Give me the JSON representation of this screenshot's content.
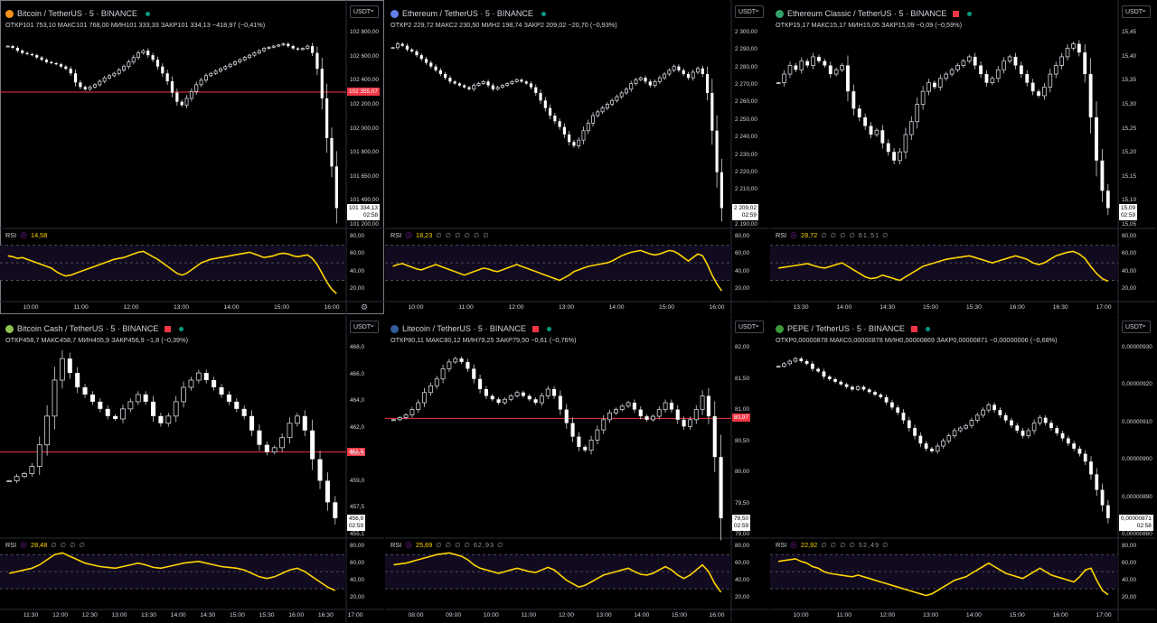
{
  "accent": {
    "up": "#ffffff",
    "down": "#ffffff",
    "rsi_line": "#ffd400",
    "last_line": "#f23645",
    "badge": "#f23645",
    "live_dot": "#089981"
  },
  "panes": [
    {
      "id": "btc",
      "title": "Bitcoin / TetherUS · 5 · BINANCE",
      "icon_color": "#f7931a",
      "flag": false,
      "active": true,
      "ohlc": "ОТКР101 753,10  МАКС101 768,00  МИН101 333,33  ЗАКР101 334,13  −418,97 (−0,41%)",
      "currency": "USDT",
      "y_labels": [
        "102 800,00",
        "102 600,00",
        "102 400,00",
        "102 200,00",
        "102 000,00",
        "101 800,00",
        "101 650,00",
        "101 490,00",
        "101 200,00"
      ],
      "last_line_label": "102 355,07",
      "price_tag": [
        "101 334,13",
        "02:58"
      ],
      "rsi": {
        "label": "RSI",
        "value": "14,58",
        "extra": ""
      },
      "rsi_levels": [
        "80,00",
        "60,00",
        "40,00",
        "20,00"
      ],
      "x_labels": [
        "10:00",
        "11:00",
        "12:00",
        "13:00",
        "14:00",
        "15:00",
        "16:00"
      ],
      "gear": true,
      "closes": [
        102760,
        102745,
        102720,
        102700,
        102690,
        102680,
        102660,
        102640,
        102620,
        102610,
        102600,
        102580,
        102560,
        102520,
        102440,
        102400,
        102380,
        102400,
        102420,
        102450,
        102480,
        102500,
        102520,
        102550,
        102580,
        102620,
        102660,
        102700,
        102720,
        102680,
        102640,
        102580,
        102520,
        102450,
        102350,
        102270,
        102240,
        102300,
        102360,
        102420,
        102460,
        102500,
        102520,
        102540,
        102560,
        102580,
        102600,
        102620,
        102640,
        102660,
        102680,
        102700,
        102720,
        102740,
        102750,
        102760,
        102770,
        102780,
        102760,
        102740,
        102730,
        102740,
        102760,
        102700,
        102560,
        102300,
        101950,
        101700,
        101334
      ],
      "rsi_values": [
        58,
        57,
        55,
        56,
        54,
        52,
        50,
        48,
        46,
        44,
        40,
        37,
        35,
        36,
        38,
        40,
        42,
        44,
        46,
        48,
        50,
        52,
        54,
        55,
        56,
        58,
        60,
        62,
        63,
        60,
        57,
        54,
        50,
        46,
        42,
        38,
        36,
        38,
        42,
        46,
        50,
        52,
        54,
        55,
        56,
        57,
        58,
        59,
        60,
        61,
        62,
        60,
        58,
        56,
        57,
        58,
        60,
        61,
        60,
        58,
        57,
        58,
        59,
        55,
        48,
        38,
        28,
        20,
        15
      ]
    },
    {
      "id": "eth",
      "title": "Ethereum / TetherUS · 5 · BINANCE",
      "icon_color": "#627eea",
      "flag": false,
      "active": false,
      "ohlc": "ОТКР2 229,72  МАКС2 230,50  МИН2 198,74  ЗАКР2 209,02  −20,70 (−0,93%)",
      "currency": "USDT",
      "y_labels": [
        "2 300,00",
        "2 290,00",
        "2 280,00",
        "2 270,00",
        "2 260,00",
        "2 250,00",
        "2 240,00",
        "2 230,00",
        "2 220,00",
        "2 210,00",
        "2 200,00",
        "2 190,00"
      ],
      "last_line_label": "",
      "price_tag": [
        "2 209,02",
        "02:59"
      ],
      "rsi": {
        "label": "RSI",
        "value": "18,23",
        "extra": "∅ ∅ ∅ ∅ ∅ ∅"
      },
      "rsi_levels": [
        "80,00",
        "60,00",
        "40,00",
        "20,00"
      ],
      "x_labels": [
        "10:00",
        "11:00",
        "12:00",
        "13:00",
        "14:00",
        "15:00",
        "16:00"
      ],
      "gear": false,
      "closes": [
        2294,
        2296,
        2295,
        2293,
        2292,
        2290,
        2288,
        2286,
        2284,
        2282,
        2280,
        2278,
        2276,
        2275,
        2274,
        2273,
        2272,
        2274,
        2275,
        2276,
        2274,
        2272,
        2273,
        2274,
        2275,
        2276,
        2277,
        2276,
        2275,
        2273,
        2270,
        2266,
        2262,
        2258,
        2255,
        2252,
        2248,
        2244,
        2242,
        2245,
        2250,
        2254,
        2258,
        2260,
        2262,
        2264,
        2266,
        2268,
        2270,
        2272,
        2275,
        2277,
        2278,
        2276,
        2274,
        2276,
        2278,
        2280,
        2282,
        2284,
        2282,
        2280,
        2278,
        2281,
        2283,
        2280,
        2270,
        2250,
        2228,
        2209
      ],
      "rsi_values": [
        46,
        48,
        49,
        47,
        45,
        43,
        42,
        44,
        46,
        48,
        46,
        44,
        42,
        40,
        38,
        36,
        38,
        40,
        42,
        44,
        43,
        41,
        40,
        42,
        44,
        46,
        48,
        46,
        44,
        42,
        40,
        38,
        36,
        34,
        32,
        30,
        33,
        36,
        40,
        42,
        44,
        46,
        47,
        48,
        49,
        50,
        52,
        55,
        58,
        60,
        62,
        63,
        64,
        62,
        60,
        59,
        60,
        62,
        64,
        63,
        60,
        56,
        52,
        56,
        60,
        58,
        48,
        36,
        26,
        18
      ]
    },
    {
      "id": "etc",
      "title": "Ethereum Classic / TetherUS · 5 · BINANCE",
      "icon_color": "#33a36b",
      "flag": true,
      "active": false,
      "ohlc": "ОТКР15,17  МАКС15,17  МИН15,05  ЗАКР15,09  −0,09 (−0,59%)",
      "currency": "USDT",
      "y_labels": [
        "15,45",
        "15,40",
        "15,35",
        "15,30",
        "15,25",
        "15,20",
        "15,15",
        "15,10",
        "15,05"
      ],
      "last_line_label": "",
      "price_tag": [
        "15,09",
        "02:59"
      ],
      "rsi": {
        "label": "RSI",
        "value": "28,72",
        "extra": "∅ ∅ ∅ ∅  61,51  ∅"
      },
      "rsi_levels": [
        "80,00",
        "60,00",
        "40,00",
        "20,00"
      ],
      "x_labels": [
        "13:30",
        "14:00",
        "14:30",
        "15:00",
        "15:30",
        "16:00",
        "16:30",
        "17:00"
      ],
      "gear": false,
      "closes": [
        15.38,
        15.4,
        15.42,
        15.41,
        15.43,
        15.42,
        15.44,
        15.43,
        15.42,
        15.4,
        15.41,
        15.42,
        15.36,
        15.32,
        15.3,
        15.28,
        15.26,
        15.27,
        15.24,
        15.22,
        15.2,
        15.22,
        15.26,
        15.29,
        15.33,
        15.36,
        15.38,
        15.37,
        15.39,
        15.4,
        15.41,
        15.42,
        15.43,
        15.44,
        15.42,
        15.4,
        15.38,
        15.39,
        15.41,
        15.43,
        15.44,
        15.42,
        15.4,
        15.38,
        15.36,
        15.35,
        15.37,
        15.4,
        15.42,
        15.44,
        15.46,
        15.47,
        15.45,
        15.4,
        15.3,
        15.2,
        15.13,
        15.09
      ],
      "rsi_values": [
        44,
        45,
        46,
        47,
        48,
        49,
        47,
        45,
        44,
        46,
        48,
        50,
        46,
        42,
        38,
        34,
        32,
        33,
        36,
        34,
        32,
        30,
        34,
        38,
        42,
        46,
        48,
        50,
        52,
        54,
        55,
        56,
        57,
        58,
        56,
        54,
        52,
        50,
        52,
        54,
        56,
        58,
        56,
        54,
        50,
        48,
        50,
        54,
        58,
        60,
        62,
        63,
        60,
        55,
        46,
        38,
        32,
        29
      ]
    },
    {
      "id": "bch",
      "title": "Bitcoin Cash / TetherUS · 5 · BINANCE",
      "icon_color": "#8dc351",
      "flag": true,
      "active": false,
      "ohlc": "ОТКР458,7  МАКС458,7  МИН455,9  ЗАКР456,9  −1,8 (−0,39%)",
      "currency": "USDT",
      "y_labels": [
        "468,0",
        "466,0",
        "464,0",
        "462,0",
        "460,5",
        "459,0",
        "457,5",
        "455,1"
      ],
      "last_line_label": "461,5",
      "price_tag": [
        "456,9",
        "02:59"
      ],
      "rsi": {
        "label": "RSI",
        "value": "28,48",
        "extra": "∅ ∅ ∅ ∅"
      },
      "rsi_levels": [
        "80,00",
        "60,00",
        "40,00",
        "20,00"
      ],
      "x_labels": [
        "11:30",
        "12:00",
        "12:30",
        "13:00",
        "13:30",
        "14:00",
        "14:30",
        "15:00",
        "15:30",
        "16:00",
        "16:30",
        "17:00"
      ],
      "gear": false,
      "closes": [
        459.5,
        459.8,
        460.0,
        460.5,
        462.0,
        464.0,
        466.5,
        468.0,
        467.0,
        466.0,
        465.5,
        465.0,
        464.5,
        464.0,
        463.8,
        464.5,
        465.0,
        465.5,
        465.0,
        464.0,
        463.5,
        464.0,
        465.0,
        466.0,
        466.5,
        467.0,
        466.5,
        466.0,
        465.5,
        465.0,
        464.5,
        464.0,
        463.0,
        462.0,
        461.5,
        461.8,
        462.5,
        463.5,
        464.0,
        463.0,
        461.0,
        459.5,
        458.0,
        456.9
      ],
      "rsi_values": [
        48,
        50,
        52,
        54,
        58,
        64,
        70,
        72,
        68,
        64,
        60,
        58,
        56,
        55,
        54,
        56,
        58,
        60,
        58,
        55,
        54,
        56,
        58,
        60,
        61,
        62,
        60,
        58,
        56,
        55,
        54,
        52,
        48,
        44,
        42,
        44,
        48,
        52,
        54,
        50,
        44,
        38,
        32,
        28
      ]
    },
    {
      "id": "ltc",
      "title": "Litecoin / TetherUS · 5 · BINANCE",
      "icon_color": "#345d9d",
      "flag": true,
      "active": false,
      "ohlc": "ОТКР80,11  МАКС80,12  МИН79,25  ЗАКР79,50  −0,61 (−0,76%)",
      "currency": "USDT",
      "y_labels": [
        "82,00",
        "81,50",
        "81,00",
        "80,50",
        "80,00",
        "79,50",
        "79,00"
      ],
      "last_line_label": "80,97",
      "price_tag": [
        "79,50",
        "02:59"
      ],
      "rsi": {
        "label": "RSI",
        "value": "25,69",
        "extra": "∅ ∅ ∅ ∅  62,93  ∅"
      },
      "rsi_levels": [
        "80,00",
        "60,00",
        "40,00",
        "20,00"
      ],
      "x_labels": [
        "08:00",
        "09:00",
        "10:00",
        "11:00",
        "12:00",
        "13:00",
        "14:00",
        "15:00",
        "16:00"
      ],
      "gear": false,
      "closes": [
        80.95,
        80.98,
        81.02,
        81.1,
        81.2,
        81.35,
        81.45,
        81.55,
        81.7,
        81.8,
        81.85,
        81.8,
        81.7,
        81.55,
        81.4,
        81.3,
        81.25,
        81.2,
        81.25,
        81.3,
        81.35,
        81.3,
        81.25,
        81.2,
        81.3,
        81.4,
        81.3,
        81.1,
        80.9,
        80.7,
        80.55,
        80.5,
        80.65,
        80.8,
        80.95,
        81.05,
        81.1,
        81.15,
        81.2,
        81.1,
        81.0,
        80.95,
        81.0,
        81.1,
        81.2,
        81.1,
        80.95,
        80.85,
        80.95,
        81.1,
        81.3,
        81.0,
        80.4,
        79.5
      ],
      "rsi_values": [
        58,
        59,
        60,
        62,
        64,
        66,
        68,
        70,
        71,
        72,
        70,
        68,
        64,
        58,
        54,
        52,
        50,
        48,
        50,
        52,
        54,
        52,
        50,
        49,
        52,
        55,
        52,
        46,
        40,
        36,
        32,
        34,
        38,
        42,
        46,
        48,
        50,
        52,
        54,
        50,
        47,
        46,
        48,
        52,
        56,
        52,
        46,
        42,
        46,
        52,
        58,
        50,
        36,
        26
      ]
    },
    {
      "id": "pepe",
      "title": "PEPE / TetherUS · 5 · BINANCE",
      "icon_color": "#3c9a3c",
      "flag": true,
      "active": false,
      "ohlc": "ОТКР0,00000878  МАКС0,00000878  МИН0,00000869  ЗАКР0,00000871  −0,00000006 (−0,68%)",
      "currency": "USDT",
      "y_labels": [
        "0,00000930",
        "0,00000920",
        "0,00000910",
        "0,00000900",
        "0,00000890",
        "0,00000880"
      ],
      "last_line_label": "",
      "price_tag": [
        "0,00000871",
        "02:58"
      ],
      "rsi": {
        "label": "RSI",
        "value": "22,92",
        "extra": "∅ ∅ ∅ ∅  52,49  ∅"
      },
      "rsi_levels": [
        "80,00",
        "60,00",
        "40,00",
        "20,00"
      ],
      "x_labels": [
        "10:00",
        "11:00",
        "12:00",
        "13:00",
        "14:00",
        "15:00",
        "16:00",
        "17:00"
      ],
      "gear": false,
      "closes": [
        930,
        931,
        932,
        933,
        932,
        931,
        929,
        928,
        926,
        925,
        924,
        923,
        922,
        921,
        922,
        921,
        920,
        919,
        918,
        916,
        914,
        912,
        909,
        906,
        903,
        900,
        898,
        897,
        899,
        901,
        903,
        905,
        906,
        907,
        909,
        911,
        913,
        915,
        913,
        911,
        909,
        907,
        905,
        903,
        905,
        908,
        910,
        908,
        906,
        904,
        902,
        900,
        898,
        896,
        893,
        888,
        882,
        876,
        871
      ],
      "rsi_values": [
        62,
        63,
        64,
        65,
        62,
        60,
        56,
        54,
        50,
        48,
        47,
        46,
        45,
        44,
        46,
        44,
        42,
        40,
        38,
        36,
        34,
        32,
        30,
        28,
        26,
        24,
        22,
        24,
        28,
        32,
        36,
        40,
        42,
        44,
        48,
        52,
        56,
        60,
        56,
        52,
        48,
        46,
        44,
        42,
        46,
        50,
        54,
        50,
        46,
        44,
        42,
        40,
        38,
        44,
        52,
        54,
        40,
        28,
        23
      ]
    }
  ]
}
